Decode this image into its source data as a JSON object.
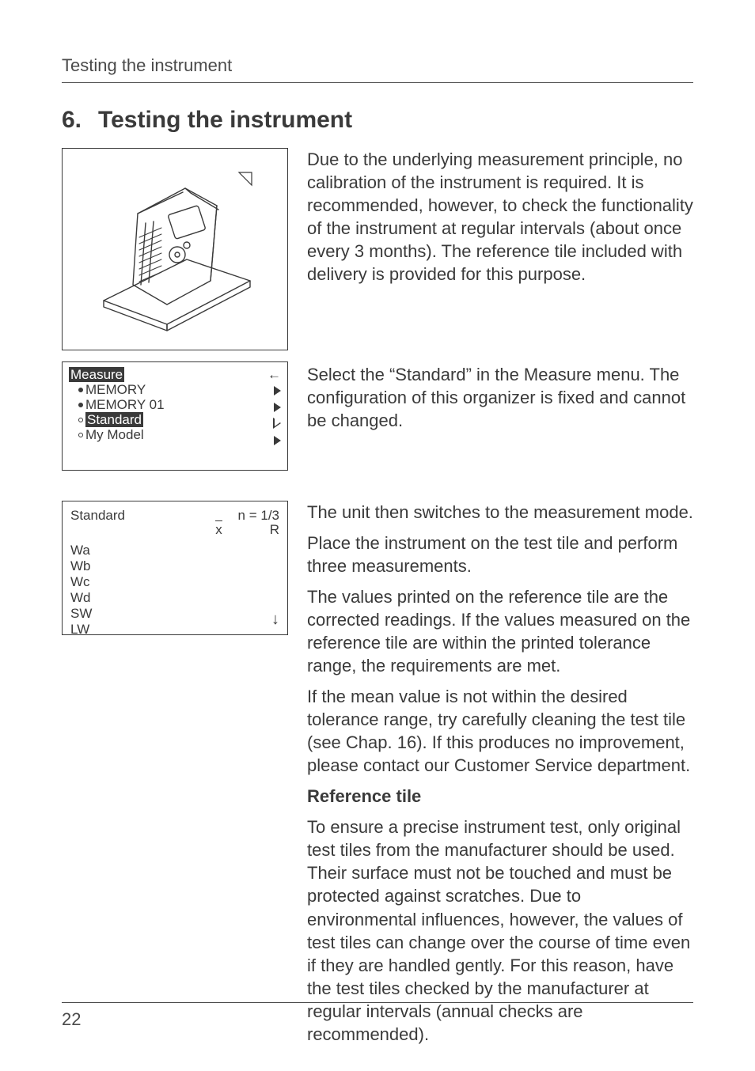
{
  "header": {
    "running_title": "Testing the instrument"
  },
  "heading": {
    "number": "6.",
    "title": "Testing the instrument"
  },
  "intro_paragraph": "Due to the underlying measurement principle, no calibration of the instrument is required. It is recommended, however, to check the functionality of the instrument at regular intervals (about once every 3 months). The reference tile included with delivery is provided for this purpose.",
  "menu_panel": {
    "title": "Measure",
    "items": [
      "MEMORY",
      "MEMORY 01",
      "Standard",
      "My Model"
    ],
    "selected_index": 2
  },
  "menu_paragraph": "Select the “Standard” in the Measure menu. The configuration of this organizer is fixed and cannot be changed.",
  "meas_panel": {
    "title": "Standard",
    "n_label": "n  =  1/3",
    "xbar": "x",
    "r_label": "R",
    "rows": [
      "Wa",
      "Wb",
      "Wc",
      "Wd",
      "SW",
      "LW"
    ]
  },
  "meas_paragraphs": [
    "The unit then switches to the measurement mode.",
    "Place the instrument on the test tile and perform three measurements.",
    "The values printed on the reference tile are the corrected readings. If the values measured on the reference tile are within the printed tolerance range, the requirements are met.",
    "If the mean value is not within the desired tolerance range, try carefully cleaning the test tile (see Chap. 16). If this produces no improvement, please contact our Customer Service department."
  ],
  "reference_tile": {
    "heading": "Reference tile",
    "paragraph": "To ensure a precise instrument test, only original test tiles from the manufacturer should be used. Their surface must not be touched and must be protected against scratches. Due to environmental influences, however, the values of test tiles can change over the course of time even if they are handled gently. For this reason, have the test tiles checked by the manufacturer at regular intervals (annual checks are recommended)."
  },
  "footer": {
    "page_number": "22"
  }
}
